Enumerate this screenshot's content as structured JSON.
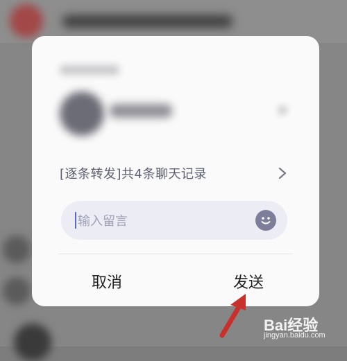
{
  "dialog": {
    "forward_text": "[逐条转发]共4条聊天记录",
    "message_placeholder": "输入留言",
    "cancel_label": "取消",
    "send_label": "发送"
  },
  "icons": {
    "chevron": "chevron-right-icon",
    "emoji": "smiley-face-icon",
    "arrow": "red-arrow-annotation"
  },
  "colors": {
    "dialog_bg": "#fafafa",
    "input_bg": "#ececf5",
    "placeholder": "#9fa2b8",
    "caret": "#5a6cc7",
    "emoji": "#7d7e9a",
    "arrow": "#c9302c"
  },
  "watermark": {
    "brand": "Bai经验",
    "site": "jingyan.baidu.com"
  }
}
